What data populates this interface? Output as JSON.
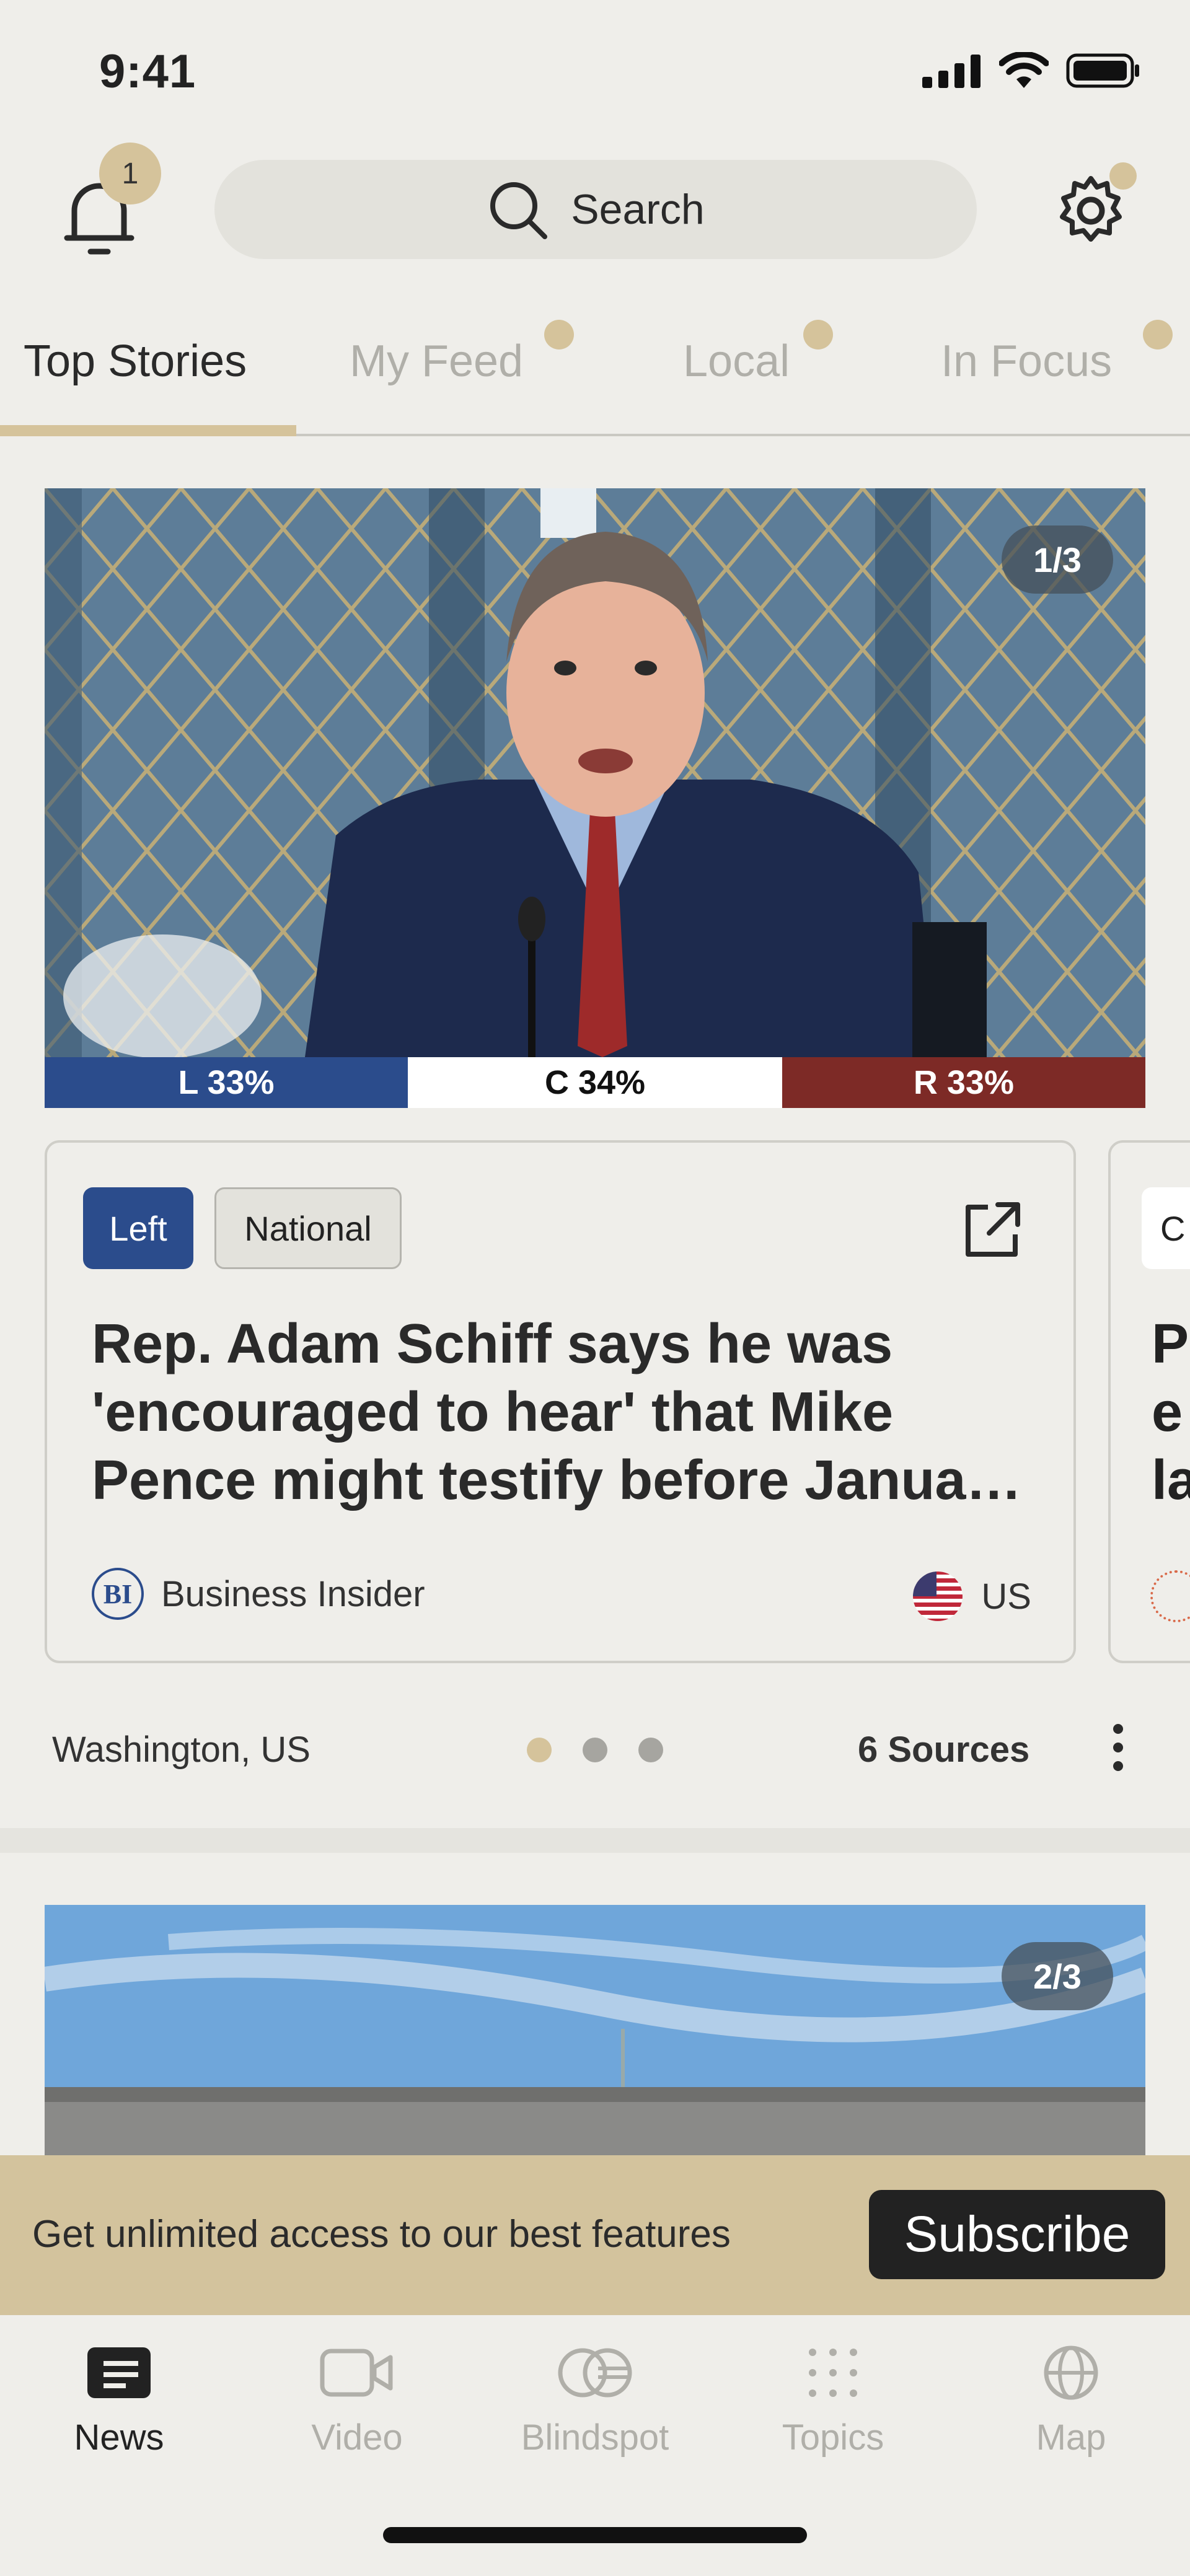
{
  "status_bar": {
    "time": "9:41"
  },
  "header": {
    "notification_count": "1",
    "search_label": "Search"
  },
  "tabs": [
    {
      "label": "Top Stories",
      "active": true
    },
    {
      "label": "My Feed",
      "active": false
    },
    {
      "label": "Local",
      "active": false
    },
    {
      "label": "In Focus",
      "active": false
    }
  ],
  "story1": {
    "pager": "1/3",
    "bias": {
      "left": "L 33%",
      "center": "C 34%",
      "right": "R 33%",
      "left_pct": 33,
      "center_pct": 34,
      "right_pct": 33
    },
    "tags": {
      "bias": "Left",
      "scope": "National"
    },
    "headline": "Rep. Adam Schiff says he was 'encouraged to hear' that Mike Pence might testify before Janua…",
    "source_name": "Business Insider",
    "source_logo": "BI",
    "country": "US",
    "location": "Washington, US",
    "sources_count": "6 Sources"
  },
  "peek_card": {
    "tag": "C",
    "headline": "P\ne\nla"
  },
  "story2": {
    "pager": "2/3"
  },
  "banner": {
    "text": "Get unlimited access to our best features",
    "button": "Subscribe"
  },
  "bottom_nav": [
    {
      "label": "News",
      "icon": "news-icon",
      "active": true
    },
    {
      "label": "Video",
      "icon": "video-icon",
      "active": false
    },
    {
      "label": "Blindspot",
      "icon": "blindspot-icon",
      "active": false
    },
    {
      "label": "Topics",
      "icon": "topics-icon",
      "active": false
    },
    {
      "label": "Map",
      "icon": "globe-icon",
      "active": false
    }
  ],
  "colors": {
    "accent": "#d5c39b",
    "left": "#2b4c8c",
    "center": "#ffffff",
    "right": "#7d2a26"
  }
}
